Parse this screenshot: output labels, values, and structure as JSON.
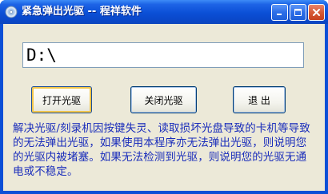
{
  "window": {
    "title": "紧急弹出光驱 -- 程祥软件",
    "minimize_icon": "minimize-icon",
    "maximize_icon": "maximize-icon",
    "close_icon": "close-icon",
    "app_icon": "cd-icon"
  },
  "drive": {
    "value": "D:\\"
  },
  "buttons": {
    "open_label": "打开光驱",
    "close_label": "关闭光驱",
    "exit_label": "退 出"
  },
  "info": {
    "text": "解决光驱/刻录机因按键失灵、读取损坏光盘导致的卡机等导致的无法弹出光驱，如果使用本程序亦无法弹出光驱，则说明您的光驱内被堵塞。如果无法检测到光驱，则说明您的光驱无通电或不稳定。"
  },
  "colors": {
    "titlebar": "#0b4fd6",
    "client_bg": "#ece9d8",
    "info_text": "#1a2dbb"
  }
}
